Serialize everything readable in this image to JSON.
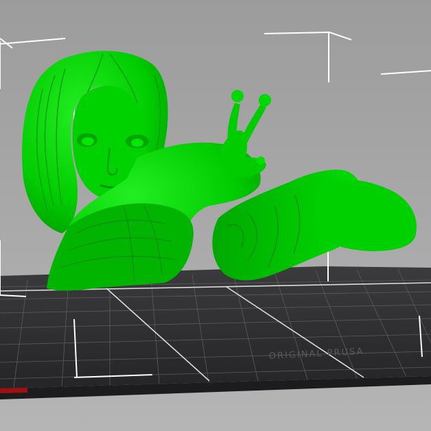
{
  "viewport": {
    "background_color": "#a9a9a9",
    "object_color": "#00d400",
    "bed_color": "#2f2f31",
    "bed_label": "ORIGINAL PRUSA"
  },
  "objects": [
    {
      "name": "girl-snail-figure",
      "selected": true
    },
    {
      "name": "log-object",
      "selected": true
    }
  ]
}
